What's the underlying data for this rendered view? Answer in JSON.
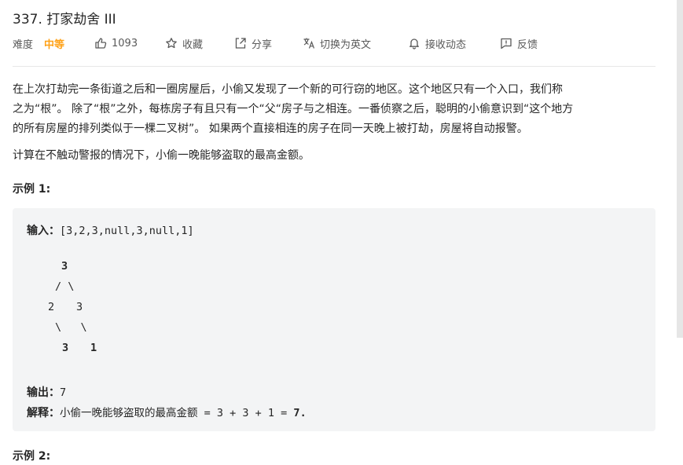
{
  "problem": {
    "title": "337. 打家劫舍 III",
    "difficulty_label": "难度",
    "difficulty_value": "中等",
    "likes": "1093",
    "favorite_label": "收藏",
    "share_label": "分享",
    "switch_lang_label": "切换为英文",
    "subscribe_label": "接收动态",
    "feedback_label": "反馈"
  },
  "description": {
    "line1": "在上次打劫完一条街道之后和一圈房屋后，小偷又发现了一个新的可行窃的地区。这个地区只有一个入口，我们称",
    "line2": "之为“根”。 除了“根”之外，每栋房子有且只有一个“父“房子与之相连。一番侦察之后，聪明的小偷意识到“这个地方",
    "line3": "的所有房屋的排列类似于一棵二叉树”。 如果两个直接相连的房子在同一天晚上被打劫，房屋将自动报警。",
    "line4": "计算在不触动警报的情况下，小偷一晚能够盗取的最高金额。"
  },
  "example1": {
    "title": "示例 1:",
    "input_label": "输入：",
    "input_value": "[3,2,3,null,3,null,1]",
    "tree_row1": "3",
    "tree_row2": "/ \\",
    "tree_row3a": "2",
    "tree_row3b": "3",
    "tree_row4": "\\   \\",
    "tree_row5a": "3",
    "tree_row5b": "1",
    "output_label": "输出：",
    "output_value": "7",
    "explain_label": "解释：",
    "explain_text": "小偷一晚能够盗取的最高金额 = 3 + 3 + 1 = ",
    "explain_result": "7",
    "explain_end": "."
  },
  "example2": {
    "title": "示例 2:"
  },
  "colors": {
    "accent": "#ffa116",
    "code_bg": "#f3f4f5",
    "text": "#262626"
  },
  "icons": [
    "thumb-up-icon",
    "star-icon",
    "share-icon",
    "translate-icon",
    "bell-icon",
    "feedback-icon"
  ]
}
